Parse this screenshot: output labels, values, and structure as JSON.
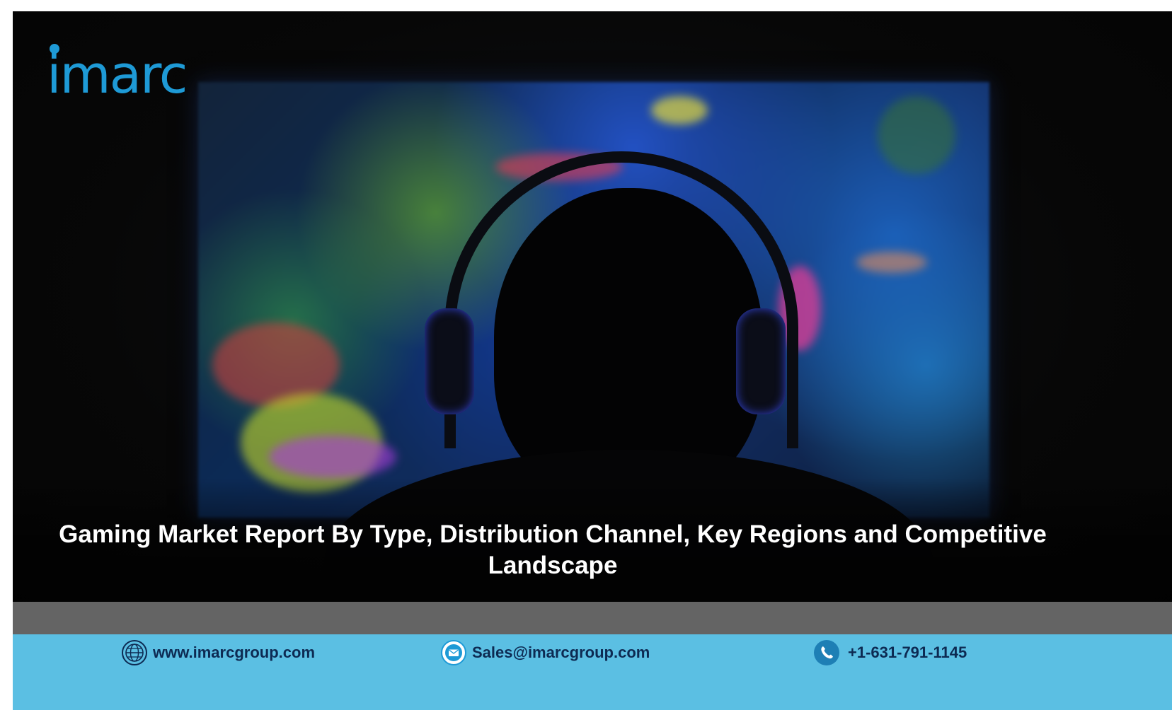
{
  "brand": {
    "logo_text": "imarc",
    "accent": "#1e9ad6"
  },
  "hero": {
    "title": "Gaming Market Report By Type, Distribution Channel, Key Regions and Competitive Landscape"
  },
  "contacts": {
    "website": {
      "icon": "globe-icon",
      "text": "www.imarcgroup.com"
    },
    "email": {
      "icon": "mail-icon",
      "text": "Sales@imarcgroup.com"
    },
    "phone": {
      "icon": "phone-icon",
      "text": "+1-631-791-1145"
    }
  },
  "colors": {
    "contact_bar": "#5bbfe3",
    "grey_strip": "#646464",
    "contact_text": "#0d2a52"
  }
}
